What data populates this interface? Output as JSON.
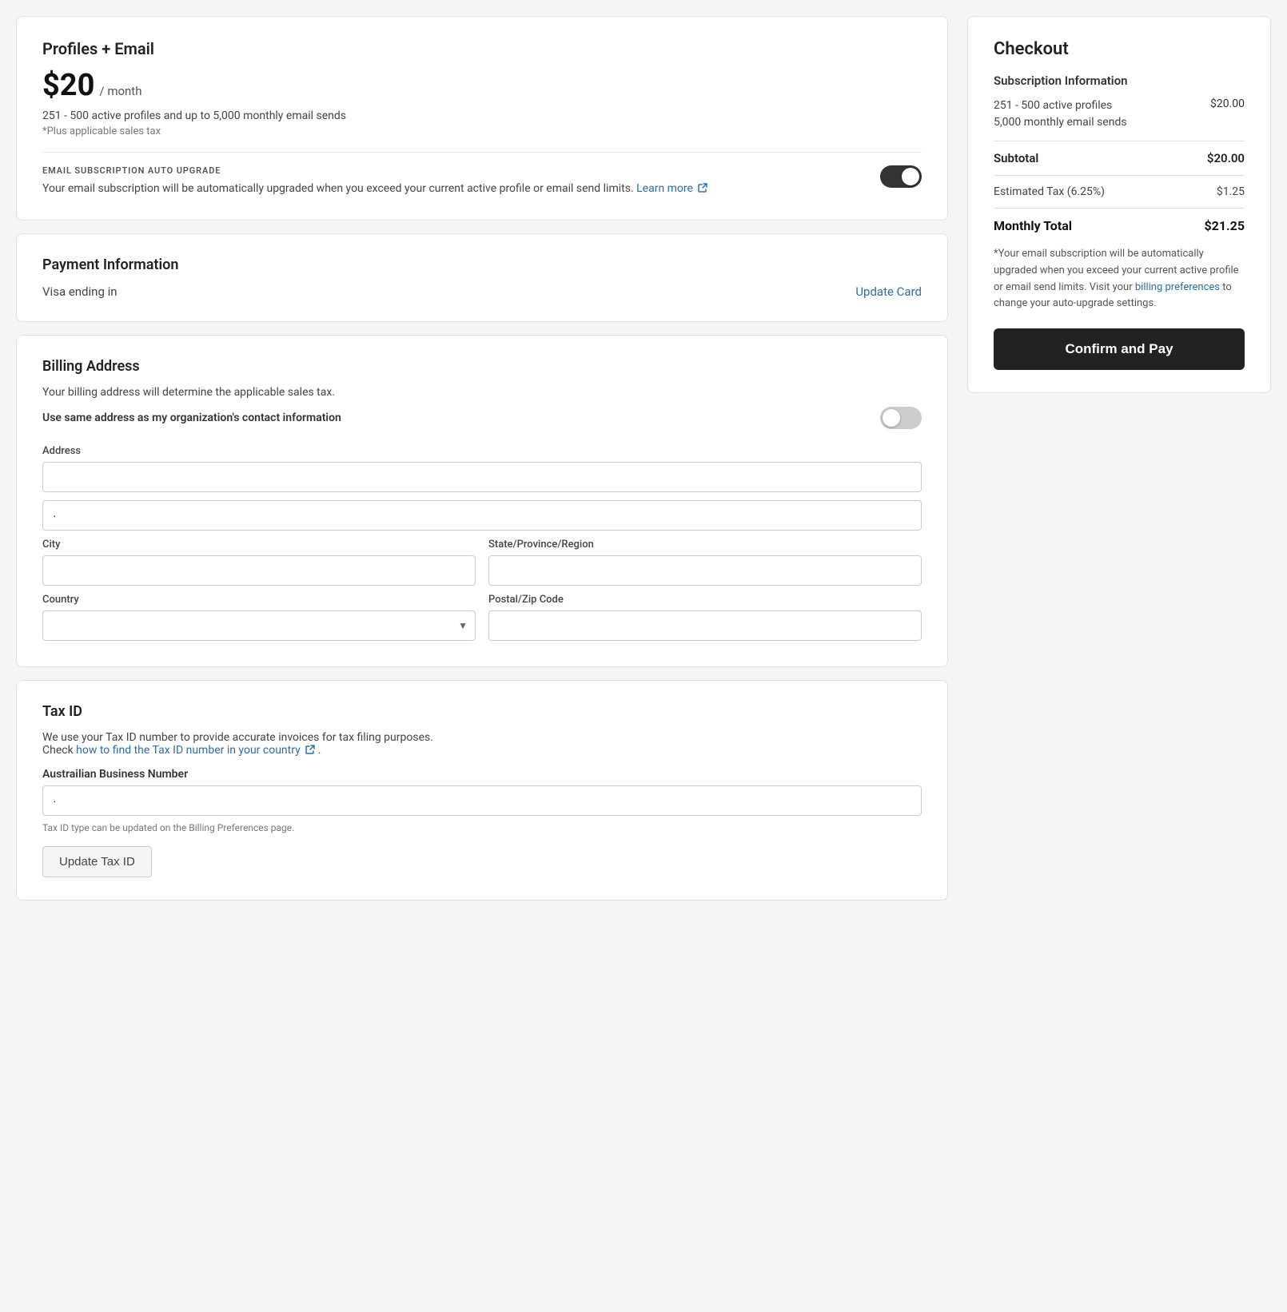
{
  "profiles_card": {
    "title": "Profiles + Email",
    "price": "$20",
    "period": "/ month",
    "description": "251 - 500 active profiles and up to 5,000 monthly email sends",
    "tax_note": "*Plus applicable sales tax",
    "auto_upgrade_label": "EMAIL SUBSCRIPTION AUTO UPGRADE",
    "auto_upgrade_text": "Your email subscription will be automatically upgraded when you exceed your current active profile or email send limits.",
    "learn_more_text": "Learn more",
    "toggle_on": true
  },
  "payment_card": {
    "title": "Payment Information",
    "visa_label": "Visa ending in",
    "update_card_label": "Update Card"
  },
  "billing_card": {
    "title": "Billing Address",
    "description": "Your billing address will determine the applicable sales tax.",
    "same_address_label": "Use same address as my organization's contact information",
    "toggle_on": false,
    "address_label": "Address",
    "city_label": "City",
    "state_label": "State/Province/Region",
    "country_label": "Country",
    "postal_label": "Postal/Zip Code",
    "address_line1_value": "",
    "address_line2_value": ".",
    "city_value": "",
    "state_value": "",
    "country_value": "",
    "postal_value": ""
  },
  "taxid_card": {
    "title": "Tax ID",
    "description": "We use your Tax ID number to provide accurate invoices for tax filing purposes.",
    "check_text": "Check",
    "how_to_link_text": "how to find the Tax ID number in your country",
    "period": ".",
    "business_number_label": "Austrailian Business Number",
    "input_value": ".",
    "hint_text": "Tax ID type can be updated on the Billing Preferences page.",
    "update_button_label": "Update Tax ID"
  },
  "checkout": {
    "title": "Checkout",
    "subscription_label": "Subscription Information",
    "profiles_label": "251 - 500 active profiles",
    "email_sends_label": "5,000 monthly email sends",
    "profiles_price": "$20.00",
    "subtotal_label": "Subtotal",
    "subtotal_value": "$20.00",
    "tax_label": "Estimated Tax (6.25%)",
    "tax_value": "$1.25",
    "monthly_total_label": "Monthly Total",
    "monthly_total_value": "$21.25",
    "note_text": "*Your email subscription will be automatically upgraded when you exceed your current active profile or email send limits. Visit your",
    "billing_preferences_text": "billing preferences",
    "note_suffix": "to change your auto-upgrade settings.",
    "confirm_button_label": "Confirm and Pay"
  }
}
